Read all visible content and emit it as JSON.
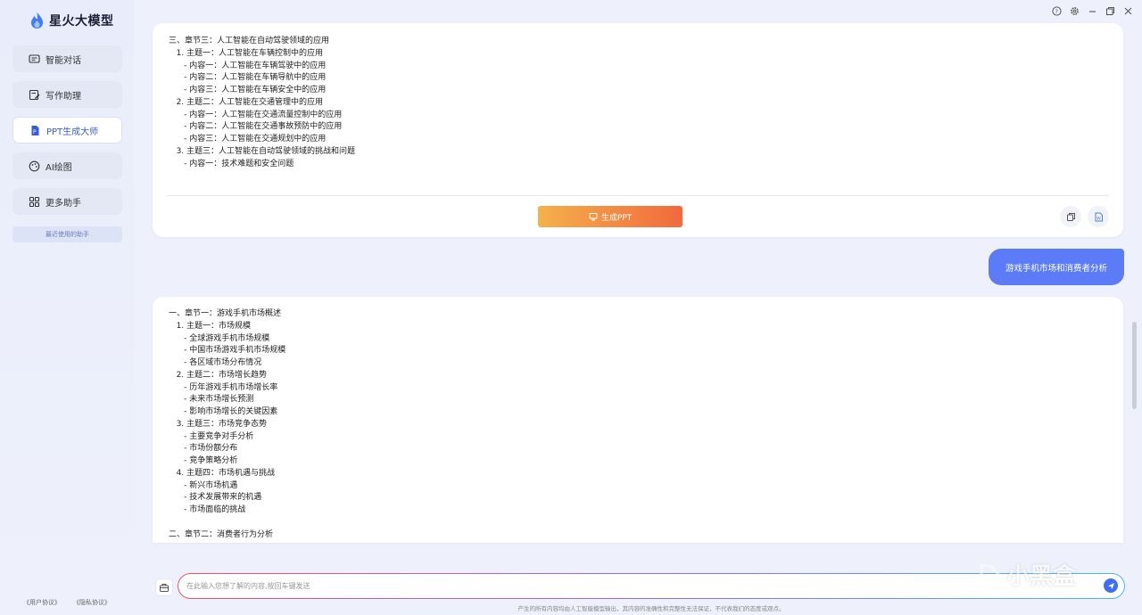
{
  "app": {
    "title": "星火大模型"
  },
  "sidebar": {
    "items": [
      {
        "label": "智能对话",
        "icon": "chat-icon"
      },
      {
        "label": "写作助理",
        "icon": "edit-icon"
      },
      {
        "label": "PPT生成大师",
        "icon": "ppt-icon",
        "active": true
      },
      {
        "label": "AI绘图",
        "icon": "palette-icon"
      },
      {
        "label": "更多助手",
        "icon": "grid-icon"
      }
    ],
    "recent_label": "最近使用的助手",
    "user_agreement": "《用户协议》",
    "privacy_policy": "《隐私协议》"
  },
  "messages": {
    "outline1": [
      "三、章节三：人工智能在自动驾驶领域的应用",
      "   1. 主题一：人工智能在车辆控制中的应用",
      "      - 内容一：人工智能在车辆驾驶中的应用",
      "      - 内容二：人工智能在车辆导航中的应用",
      "      - 内容三：人工智能在车辆安全中的应用",
      "   2. 主题二：人工智能在交通管理中的应用",
      "      - 内容一：人工智能在交通流量控制中的应用",
      "      - 内容二：人工智能在交通事故预防中的应用",
      "      - 内容三：人工智能在交通规划中的应用",
      "   3. 主题三：人工智能在自动驾驶领域的挑战和问题",
      "      - 内容一：技术难题和安全问题"
    ],
    "generate_ppt_label": "生成PPT",
    "user_query": "游戏手机市场和消费者分析",
    "outline2": [
      "一、章节一：游戏手机市场概述",
      "   1. 主题一：市场规模",
      "      - 全球游戏手机市场规模",
      "      - 中国市场游戏手机市场规模",
      "      - 各区域市场分布情况",
      "   2. 主题二：市场增长趋势",
      "      - 历年游戏手机市场增长率",
      "      - 未来市场增长预测",
      "      - 影响市场增长的关键因素",
      "   3. 主题三：市场竞争态势",
      "      - 主要竞争对手分析",
      "      - 市场份额分布",
      "      - 竞争策略分析",
      "   4. 主题四：市场机遇与挑战",
      "      - 新兴市场机遇",
      "      - 技术发展带来的机遇",
      "      - 市场面临的挑战",
      " ",
      "二、章节二：消费者行为分析"
    ]
  },
  "input": {
    "placeholder": "在此输入您想了解的内容,按回车键发送",
    "value": ""
  },
  "disclaimer": "产生的所有内容均由人工智能模型输出，其内容的准确性和完整性无法保证，不代表我们的态度或观点。",
  "watermark": "小黑盒",
  "colors": {
    "accent": "#5b7cf6",
    "ppt_button_start": "#f5b04c",
    "ppt_button_end": "#f06a3d"
  }
}
